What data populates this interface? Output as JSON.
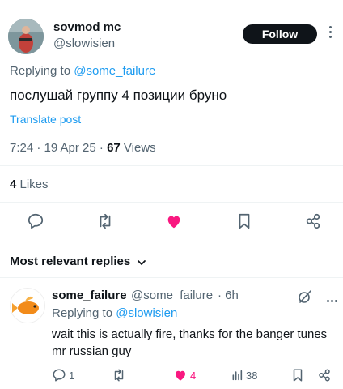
{
  "post": {
    "author_name": "sovmod mc",
    "author_handle": "@slowisien",
    "follow_label": "Follow",
    "replying_prefix": "Replying to ",
    "replying_to": "@some_failure",
    "text": "послушай группу 4 позиции бруно",
    "translate_label": "Translate post",
    "timestamp": "7:24 · 19 Apr 25 · ",
    "views_count": "67",
    "views_label": " Views",
    "likes_count": "4",
    "likes_label": " Likes",
    "liked": true
  },
  "replies_section": {
    "sort_label": "Most relevant replies"
  },
  "reply": {
    "author_name": "some_failure",
    "author_handle": "@some_failure",
    "time": "· 6h",
    "replying_prefix": "Replying to ",
    "replying_to": "@slowisien",
    "text": "wait this is actually fire, thanks for the banger tunes mr russian guy",
    "reply_count": "1",
    "repost_count": "",
    "like_count": "4",
    "view_count": "38",
    "liked": true
  },
  "colors": {
    "accent": "#1d9bf0",
    "like": "#f91880",
    "muted": "#536471",
    "text": "#0f1419"
  }
}
